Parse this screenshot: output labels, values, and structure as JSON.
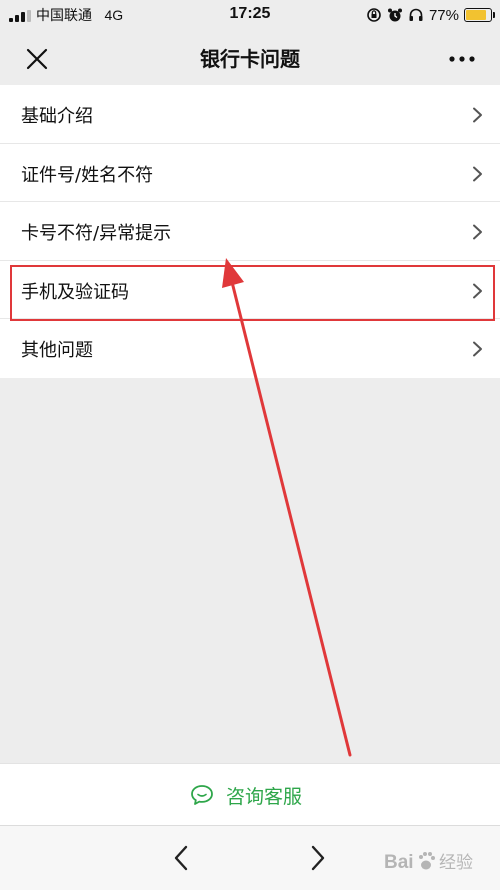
{
  "status_bar": {
    "carrier": "中国联通",
    "network": "4G",
    "time": "17:25",
    "battery": "77%",
    "battery_level": 0.77,
    "icons": [
      "signal-icon",
      "orientation-lock-icon",
      "alarm-icon",
      "headphones-icon",
      "battery-icon"
    ]
  },
  "nav": {
    "title": "银行卡问题",
    "close_icon": "close-icon",
    "more_icon": "more-icon"
  },
  "menu": {
    "items": [
      {
        "label": "基础介绍"
      },
      {
        "label": "证件号/姓名不符"
      },
      {
        "label": "卡号不符/异常提示"
      },
      {
        "label": "手机及验证码",
        "highlighted": true
      },
      {
        "label": "其他问题"
      }
    ]
  },
  "consult": {
    "label": "咨询客服",
    "icon": "chat-bubble-icon"
  },
  "toolbar": {
    "back_icon": "chevron-left-icon",
    "forward_icon": "chevron-right-icon"
  },
  "watermark": {
    "text": "Bai 经验"
  },
  "colors": {
    "background": "#ededed",
    "accent_green": "#2ea64a",
    "annotation_red": "#e0383a"
  }
}
